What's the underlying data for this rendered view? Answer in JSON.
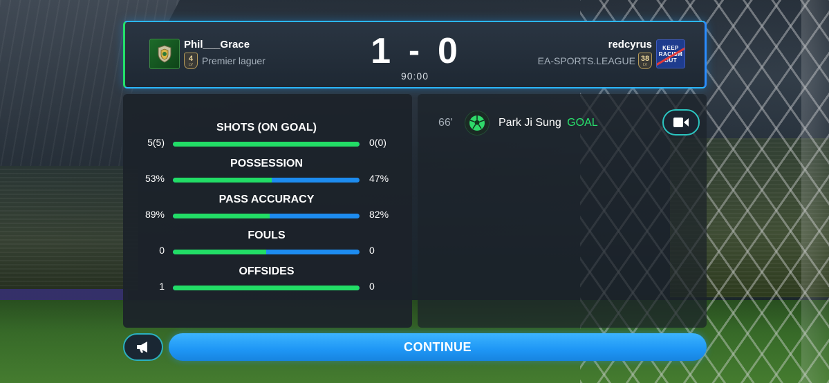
{
  "home_team": {
    "name": "Phil___Grace",
    "level": "4",
    "level_label": "LV",
    "league": "Premier laguer",
    "crest_icon": "shield-crest-icon"
  },
  "away_team": {
    "name": "redcyrus",
    "level": "38",
    "level_label": "LV",
    "league": "EA-SPORTS.LEAGUE",
    "crest": {
      "line1": "KEEP",
      "line2": "RACISM",
      "line3": "OUT"
    }
  },
  "score": {
    "home": "1",
    "separator": "-",
    "away": "0",
    "time": "90:00"
  },
  "stats": [
    {
      "label": "SHOTS (ON GOAL)",
      "home": "5(5)",
      "away": "0(0)",
      "home_share": 1.0
    },
    {
      "label": "POSSESSION",
      "home": "53%",
      "away": "47%",
      "home_share": 0.53
    },
    {
      "label": "PASS ACCURACY",
      "home": "89%",
      "away": "82%",
      "home_share": 0.52
    },
    {
      "label": "FOULS",
      "home": "0",
      "away": "0",
      "home_share": 0.5
    },
    {
      "label": "OFFSIDES",
      "home": "1",
      "away": "0",
      "home_share": 1.0
    }
  ],
  "events": [
    {
      "minute": "66'",
      "player": "Park Ji Sung",
      "type": "GOAL",
      "icon": "football-icon"
    }
  ],
  "buttons": {
    "continue": "CONTINUE",
    "announce_icon": "megaphone-icon",
    "video_icon": "video-camera-icon"
  },
  "colors": {
    "home_accent": "#22dd66",
    "away_accent": "#1d8cf0",
    "goal_text": "#29e06c",
    "continue_button": "#1e96f5"
  }
}
